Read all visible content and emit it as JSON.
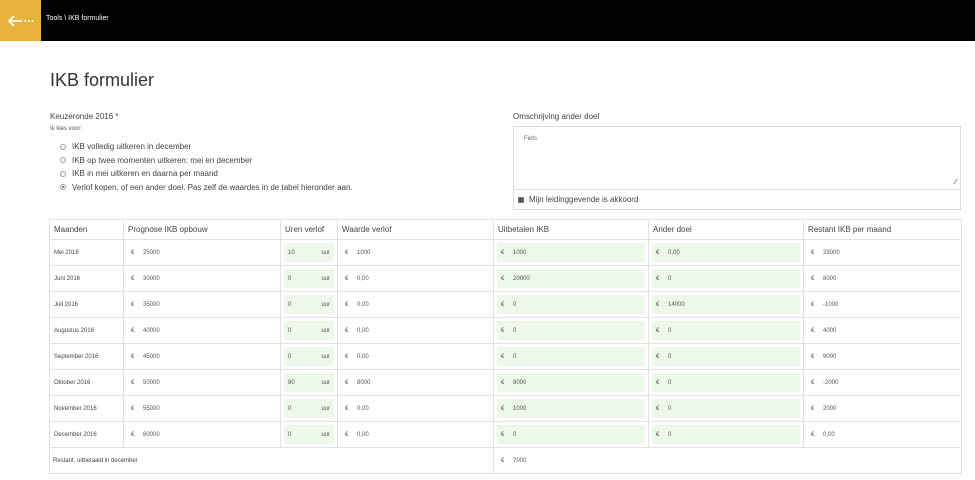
{
  "header": {
    "breadcrumb": "Tools \\ IKB formulier"
  },
  "page": {
    "title": "IKB formulier"
  },
  "keuze": {
    "label": "Keuzeronde 2016 *",
    "sublabel": "Ik kies voor:",
    "options": [
      "IKB volledig uitkeren in december",
      "IKB op twee momenten uitkeren: mei en december",
      "IKB in mei uitkeren en daarna per maand",
      "Verlof kopen, of een ander doel. Pas zelf de waardes in de tabel hieronder aan."
    ],
    "selected_index": 3
  },
  "omschrijving": {
    "label": "Omschrijving ander doel",
    "value": "Fiets",
    "approval_label": "Mijn leidinggevende is akkoord"
  },
  "table": {
    "currency": "€",
    "unit": "uur",
    "headers": [
      "Maanden",
      "Prognose IKB opbouw",
      "Uren verlof",
      "Waarde verlof",
      "Uitbetalen IKB",
      "Ander doel",
      "Restant IKB per maand"
    ],
    "rows": [
      {
        "month": "Mei 2016",
        "prognose": "25000",
        "uren": "10",
        "waarde": "1000",
        "uitbetalen": "1000",
        "ander": "0,00",
        "restant": "23000"
      },
      {
        "month": "Juni 2016",
        "prognose": "30000",
        "uren": "0",
        "waarde": "0,00",
        "uitbetalen": "20000",
        "ander": "0",
        "restant": "8000"
      },
      {
        "month": "Juli 2016",
        "prognose": "35000",
        "uren": "0",
        "waarde": "0,00",
        "uitbetalen": "0",
        "ander": "14000",
        "restant": "-1000"
      },
      {
        "month": "Augustus 2016",
        "prognose": "40000",
        "uren": "0",
        "waarde": "0,00",
        "uitbetalen": "0",
        "ander": "0",
        "restant": "4000"
      },
      {
        "month": "September 2016",
        "prognose": "45000",
        "uren": "0",
        "waarde": "0,00",
        "uitbetalen": "0",
        "ander": "0",
        "restant": "9000"
      },
      {
        "month": "Oktober 2016",
        "prognose": "50000",
        "uren": "80",
        "waarde": "8000",
        "uitbetalen": "8000",
        "ander": "0",
        "restant": "-2000"
      },
      {
        "month": "November 2016",
        "prognose": "55000",
        "uren": "0",
        "waarde": "0,00",
        "uitbetalen": "1000",
        "ander": "0",
        "restant": "2000"
      },
      {
        "month": "December 2016",
        "prognose": "60000",
        "uren": "0",
        "waarde": "0,00",
        "uitbetalen": "0",
        "ander": "0",
        "restant": "0,00"
      }
    ],
    "summary": {
      "label": "Restant, uitbetaald in december",
      "value": "7000"
    }
  },
  "icons": {
    "back": "arrow-left-icon"
  },
  "colors": {
    "accent": "#e7b33b",
    "header_bg": "#000000",
    "input_bg": "#edf7ea"
  }
}
